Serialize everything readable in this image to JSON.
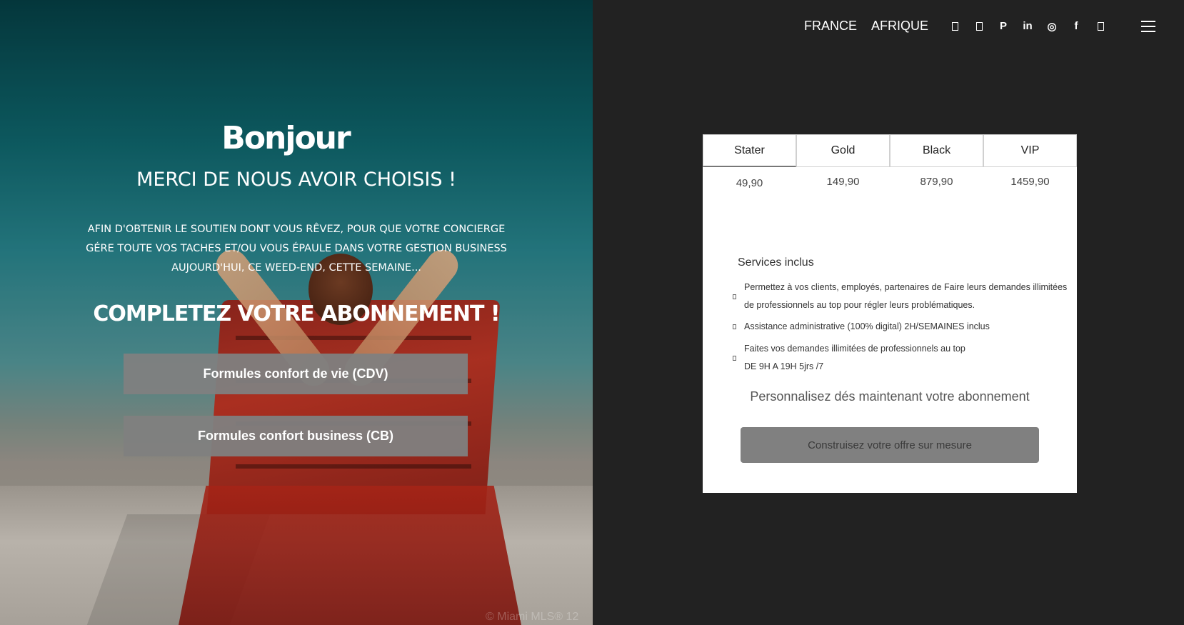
{
  "hero": {
    "greeting": "Bonjour",
    "subtitle": "MERCI DE NOUS AVOIR CHOISIS !",
    "paragraph_lines": [
      "AFIN D'OBTENIR LE SOUTIEN DONT VOUS RÊVEZ, POUR QUE VOTRE CONCIERGE",
      "GÉRE TOUTE VOS TACHES ET/OU VOUS ÉPAULE DANS VOTRE GESTION BUSINESS",
      "AUJOURD'HUI, CE WEED-END, CETTE SEMAINE..."
    ],
    "cta_title": "COMPLETEZ VOTRE ABONNEMENT !",
    "buttons": [
      "Formules confort de vie (CDV)",
      "Formules confort business (CB)"
    ]
  },
  "topnav": {
    "links": [
      "FRANCE",
      "AFRIQUE"
    ],
    "social_icons": [
      "square-icon",
      "square-icon",
      "pinterest-icon",
      "linkedin-icon",
      "instagram-icon",
      "facebook-icon",
      "square-icon"
    ],
    "social_glyphs": [
      "",
      "",
      "P",
      "in",
      "◎",
      "f",
      ""
    ]
  },
  "pricing": {
    "tabs": [
      "Stater",
      "Gold",
      "Black",
      "VIP"
    ],
    "active_tab": "Stater",
    "prices": [
      "49,90",
      "149,90",
      "879,90",
      "1459,90"
    ],
    "services_title": "Services inclus",
    "services": [
      [
        "Permettez à vos clients, employés, partenaires de Faire leurs demandes illimitées",
        "de professionnels au top pour régler leurs problématiques."
      ],
      [
        "Assistance administrative (100% digital) 2H/SEMAINES inclus"
      ],
      [
        "Faites vos demandes illimitées de professionnels au top",
        "DE 9H A 19H 5jrs /7"
      ]
    ],
    "personalize_text": "Personnalisez dés maintenant votre abonnement",
    "offer_button": "Construisez votre offre sur mesure"
  },
  "watermark": "© Miami MLS® 12",
  "colors": {
    "page_bg": "#222222",
    "hero_button_bg": "#808080",
    "card_bg": "#ffffff",
    "offer_button_bg": "#808080"
  }
}
